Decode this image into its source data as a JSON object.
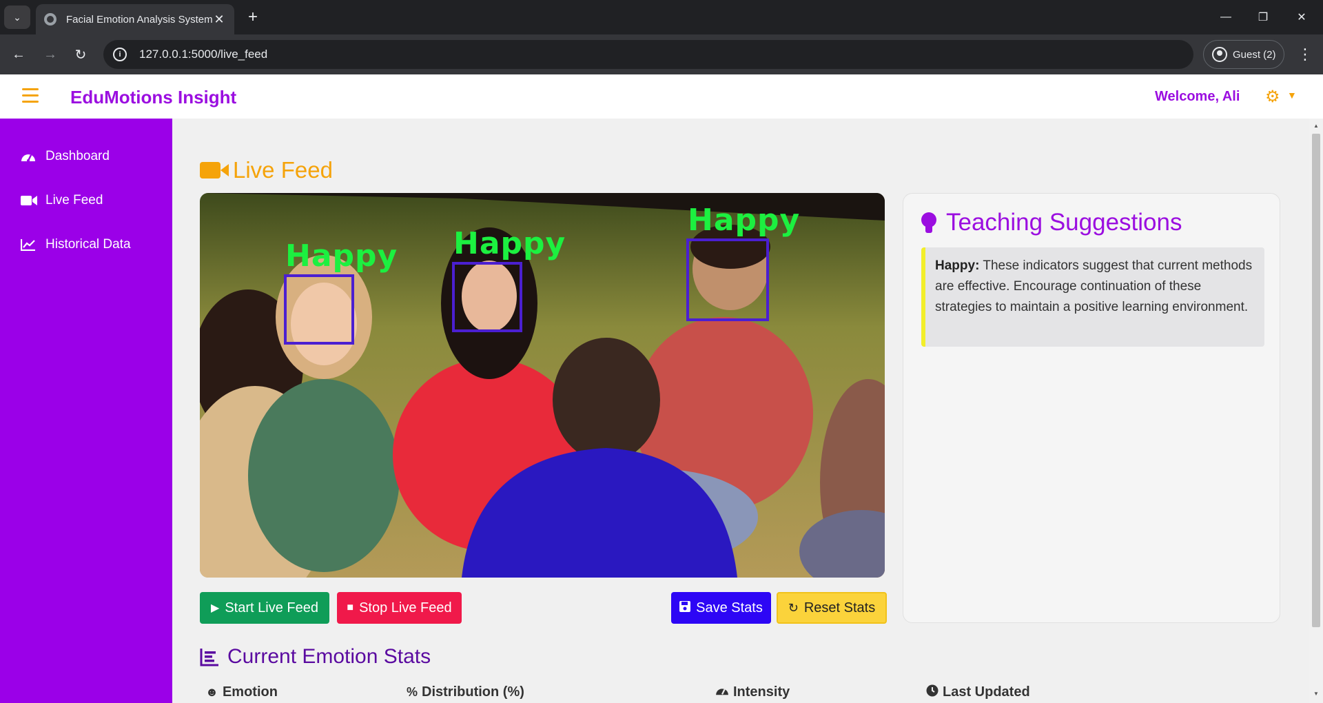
{
  "browser": {
    "tab_title": "Facial Emotion Analysis System",
    "tab_close": "✕",
    "new_tab": "+",
    "url": "127.0.0.1:5000/live_feed",
    "profile": "Guest (2)"
  },
  "app": {
    "brand": "EduMotions Insight",
    "welcome": "Welcome, Ali"
  },
  "sidebar": {
    "items": [
      {
        "label": "Dashboard",
        "icon": "gauge-icon"
      },
      {
        "label": "Live Feed",
        "icon": "video-camera-icon"
      },
      {
        "label": "Historical Data",
        "icon": "line-chart-icon"
      }
    ]
  },
  "live_feed": {
    "title": "Live Feed",
    "detections": [
      {
        "label": "Happy"
      },
      {
        "label": "Happy"
      },
      {
        "label": "Happy"
      }
    ],
    "buttons": {
      "start": "Start Live Feed",
      "stop": "Stop Live Feed",
      "save": "Save Stats",
      "reset": "Reset Stats"
    }
  },
  "suggestions": {
    "title": "Teaching Suggestions",
    "emotion": "Happy:",
    "text": "These indicators suggest that current methods are effective. Encourage continuation of these strategies to maintain a positive learning environment."
  },
  "stats": {
    "title": "Current Emotion Stats",
    "columns": [
      "Emotion",
      "Distribution (%)",
      "Intensity",
      "Last Updated"
    ]
  },
  "colors": {
    "brand_purple": "#9b0ee0",
    "sidebar": "#9b00e8",
    "accent_orange": "#f5a30a",
    "start_green": "#0f9d58",
    "stop_red": "#f0194a",
    "save_blue": "#2d06f5",
    "reset_yellow": "#fbd33b",
    "detection_green": "#1cf040",
    "box_blue": "#4b1fd1"
  }
}
